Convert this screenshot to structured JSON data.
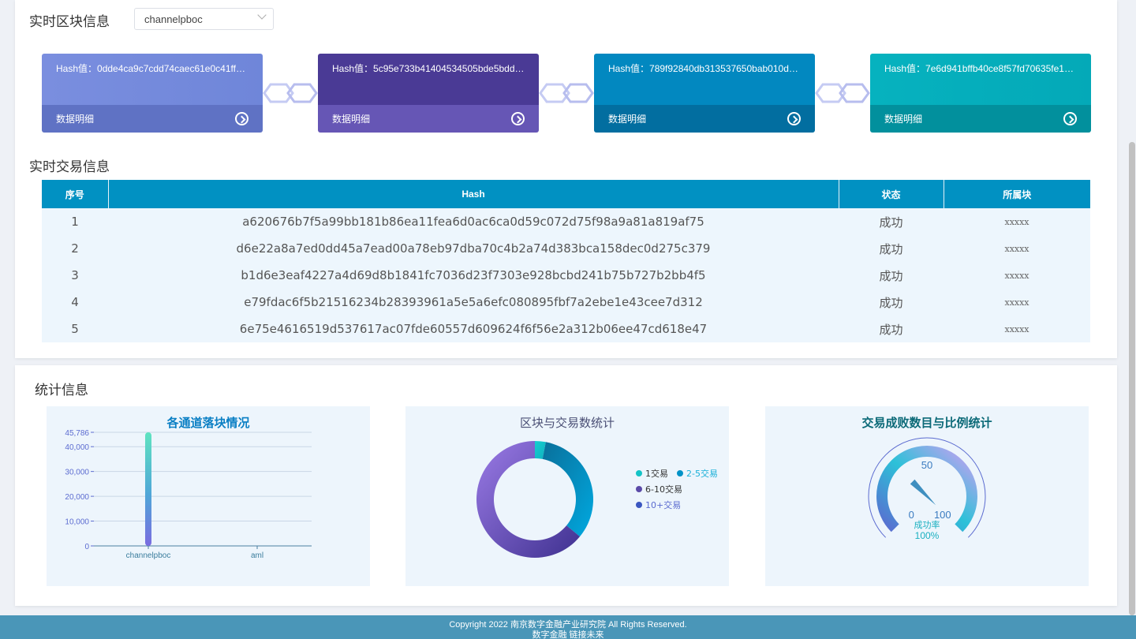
{
  "realtime_block": {
    "title": "实时区块信息",
    "channel_select": "channelpboc",
    "blocks": [
      {
        "hash": "Hash值：0dde4ca9c7cdd74caec61e0c41ff570…",
        "detail": "数据明细",
        "top_color": "#6f86d9",
        "bottom_color": "#5f72c4"
      },
      {
        "hash": "Hash值：5c95e733b41404534505bde5bddfa9…",
        "detail": "数据明细",
        "top_color": "#4a3a95",
        "bottom_color": "#6656b5"
      },
      {
        "hash": "Hash值：789f92840db313537650bab010d339…",
        "detail": "数据明细",
        "top_color": "#0288c0",
        "bottom_color": "#026ea0"
      },
      {
        "hash": "Hash值：7e6d941bffb40ce8f57fd70635fe1244…",
        "detail": "数据明细",
        "top_color": "#04a9b8",
        "bottom_color": "#02909d"
      }
    ]
  },
  "realtime_tx": {
    "title": "实时交易信息",
    "headers": [
      "序号",
      "Hash",
      "状态",
      "所属块"
    ],
    "rows": [
      {
        "no": "1",
        "hash": "a620676b7f5a99bb181b86ea11fea6d0ac6ca0d59c072d75f98a9a81a819af75",
        "status": "成功",
        "block": "xxxxx"
      },
      {
        "no": "2",
        "hash": "d6e22a8a7ed0dd45a7ead00a78eb97dba70c4b2a74d383bca158dec0d275c379",
        "status": "成功",
        "block": "xxxxx"
      },
      {
        "no": "3",
        "hash": "b1d6e3eaf4227a4d69d8b1841fc7036d23f7303e928bcbd241b75b727b2bb4f5",
        "status": "成功",
        "block": "xxxxx"
      },
      {
        "no": "4",
        "hash": "e79fdac6f5b21516234b28393961a5e5a6efc080895fbf7a2ebe1e43cee7d312",
        "status": "成功",
        "block": "xxxxx"
      },
      {
        "no": "5",
        "hash": "6e75e4616519d537617ac07fde60557d609624f6f56e2a312b06ee47cd618e47",
        "status": "成功",
        "block": "xxxxx"
      }
    ]
  },
  "stats": {
    "title": "统计信息",
    "bar_panel_title": "各通道落块情况",
    "donut_panel_title": "区块与交易数统计",
    "gauge_panel_title": "交易成败数目与比例统计"
  },
  "chart_data": [
    {
      "type": "bar",
      "title": "各通道落块情况",
      "categories": [
        "channelpboc",
        "aml"
      ],
      "values": [
        45786,
        0
      ],
      "ylim": [
        0,
        45786
      ],
      "yticks": [
        "45,786",
        "40,000",
        "30,000",
        "20,000",
        "10,000",
        "0"
      ],
      "ytick_values": [
        45786,
        40000,
        30000,
        20000,
        10000,
        0
      ],
      "grid": true
    },
    {
      "type": "pie",
      "title": "区块与交易数统计",
      "labels": [
        "1交易",
        "2-5交易",
        "6-10交易",
        "10+交易"
      ],
      "values": [
        3,
        33,
        64,
        0
      ],
      "colors": [
        "#14c3c6",
        "#0192c7",
        "#5b4aa8",
        "#3a56c0"
      ],
      "legend_placement": "right"
    },
    {
      "type": "gauge",
      "title": "交易成败数目与比例统计",
      "min": 0,
      "max": 100,
      "value": 100,
      "tick_labels": [
        "0",
        "50",
        "100"
      ],
      "label": "成功率",
      "value_text": "100%"
    }
  ],
  "footer": {
    "line1": "Copyright 2022 南京数字金融产业研究院 All Rights Reserved.",
    "line2": "数字金融 链接未来"
  }
}
